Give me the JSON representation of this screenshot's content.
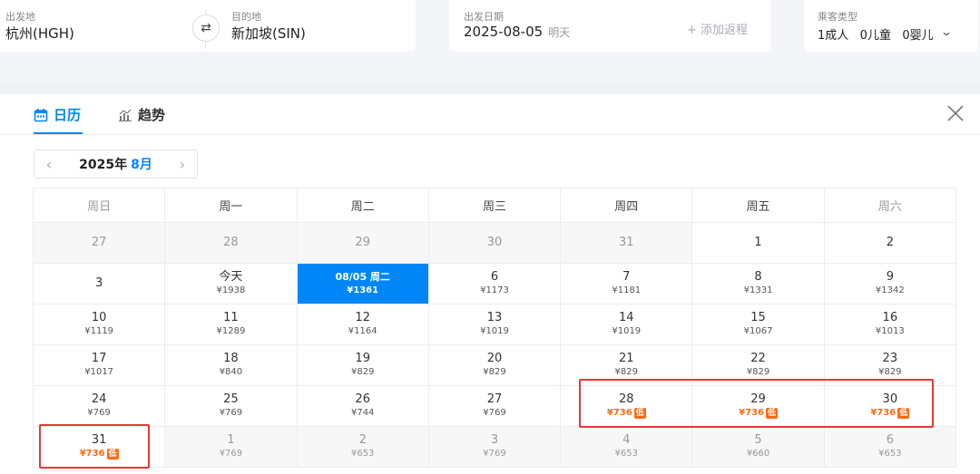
{
  "search": {
    "from_label": "出发地",
    "from_value": "杭州(HGH)",
    "to_label": "目的地",
    "to_value": "新加坡(SIN)",
    "swap_icon": "⇄",
    "date_label": "出发日期",
    "date_value": "2025-08-05",
    "date_hint": "明天",
    "add_return": "+ 添加返程",
    "pax_label": "乘客类型",
    "pax_value": "1成人   0儿童   0婴儿"
  },
  "tabs": {
    "calendar": "日历",
    "trend": "趋势"
  },
  "month": {
    "year": "2025年",
    "month": "8月"
  },
  "weekdays": [
    "周日",
    "周一",
    "周二",
    "周三",
    "周四",
    "周五",
    "周六"
  ],
  "weeks": [
    [
      {
        "d": "27",
        "p": "",
        "other": true
      },
      {
        "d": "28",
        "p": "",
        "other": true
      },
      {
        "d": "29",
        "p": "",
        "other": true
      },
      {
        "d": "30",
        "p": "",
        "other": true
      },
      {
        "d": "31",
        "p": "",
        "other": true
      },
      {
        "d": "1",
        "p": ""
      },
      {
        "d": "2",
        "p": ""
      }
    ],
    [
      {
        "d": "3",
        "p": ""
      },
      {
        "d": "今天",
        "p": "¥1938"
      },
      {
        "d": "08/05 周二",
        "p": "¥1361",
        "selected": true
      },
      {
        "d": "6",
        "p": "¥1173"
      },
      {
        "d": "7",
        "p": "¥1181"
      },
      {
        "d": "8",
        "p": "¥1331"
      },
      {
        "d": "9",
        "p": "¥1342"
      }
    ],
    [
      {
        "d": "10",
        "p": "¥1119"
      },
      {
        "d": "11",
        "p": "¥1289"
      },
      {
        "d": "12",
        "p": "¥1164"
      },
      {
        "d": "13",
        "p": "¥1019"
      },
      {
        "d": "14",
        "p": "¥1019"
      },
      {
        "d": "15",
        "p": "¥1067"
      },
      {
        "d": "16",
        "p": "¥1013"
      }
    ],
    [
      {
        "d": "17",
        "p": "¥1017"
      },
      {
        "d": "18",
        "p": "¥840"
      },
      {
        "d": "19",
        "p": "¥829"
      },
      {
        "d": "20",
        "p": "¥829"
      },
      {
        "d": "21",
        "p": "¥829"
      },
      {
        "d": "22",
        "p": "¥829"
      },
      {
        "d": "23",
        "p": "¥829"
      }
    ],
    [
      {
        "d": "24",
        "p": "¥769"
      },
      {
        "d": "25",
        "p": "¥769"
      },
      {
        "d": "26",
        "p": "¥744"
      },
      {
        "d": "27",
        "p": "¥769"
      },
      {
        "d": "28",
        "p": "¥736",
        "low": true
      },
      {
        "d": "29",
        "p": "¥736",
        "low": true
      },
      {
        "d": "30",
        "p": "¥736",
        "low": true
      }
    ],
    [
      {
        "d": "31",
        "p": "¥736",
        "low": true
      },
      {
        "d": "1",
        "p": "¥769",
        "other": true
      },
      {
        "d": "2",
        "p": "¥653",
        "other": true
      },
      {
        "d": "3",
        "p": "¥769",
        "other": true
      },
      {
        "d": "4",
        "p": "¥653",
        "other": true
      },
      {
        "d": "5",
        "p": "¥660",
        "other": true
      },
      {
        "d": "6",
        "p": "¥653",
        "other": true
      }
    ]
  ],
  "low_tag": "低",
  "colors": {
    "accent": "#0086f6",
    "low_price": "#ff6913",
    "highlight": "#e53935"
  },
  "icons": {
    "calendar": "calendar-icon",
    "trend": "trend-chart-icon",
    "close": "close-icon"
  }
}
